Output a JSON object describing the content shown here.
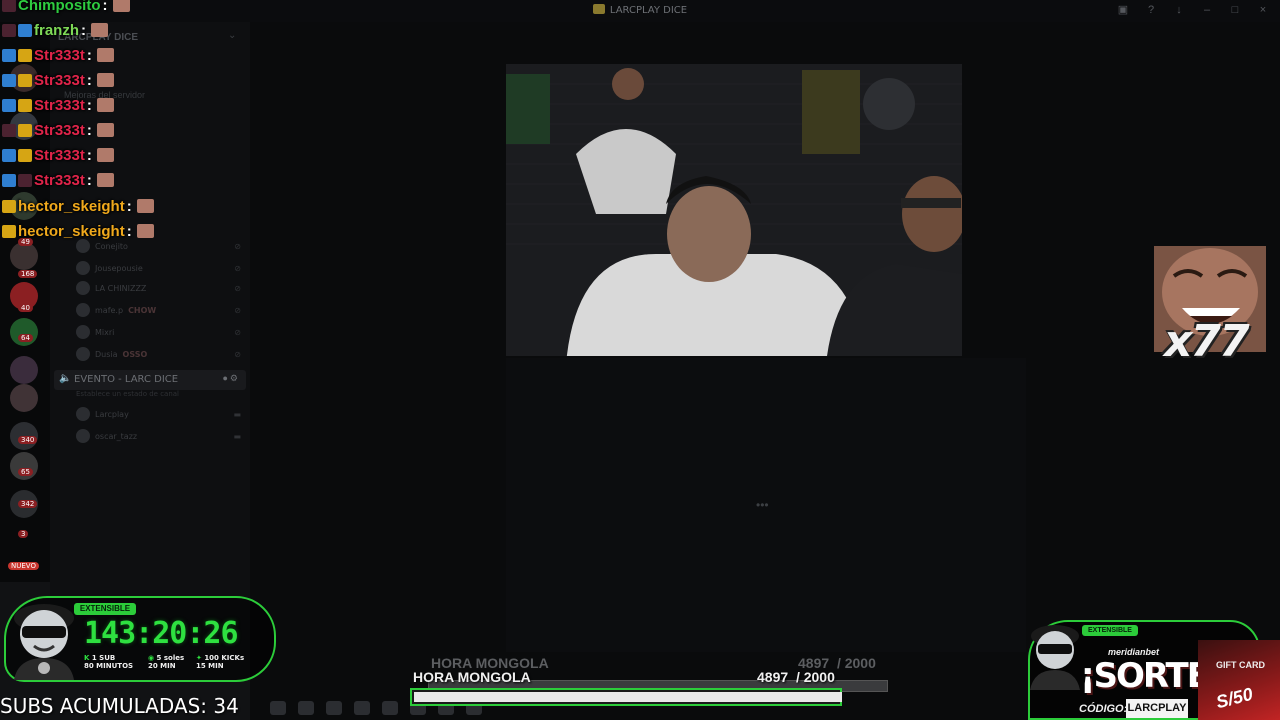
{
  "window": {
    "title": "LARCPLAY DICE"
  },
  "server": {
    "name": "LARCPLAY DICE",
    "boost_label": "Mejoras del servidor"
  },
  "guild_badges": [
    "49",
    "168",
    "40",
    "64",
    "340",
    "65",
    "342",
    "3",
    "NUEVO"
  ],
  "voice_users": [
    {
      "name": "Conejito",
      "tag": ""
    },
    {
      "name": "Jousepousie",
      "tag": ""
    },
    {
      "name": "LA CHINIZZZ",
      "tag": ""
    },
    {
      "name": "mafe.p",
      "tag": "CHOW"
    },
    {
      "name": "Mixri",
      "tag": ""
    },
    {
      "name": "Dusia",
      "tag": "OSSO"
    }
  ],
  "voice_channel": {
    "name": "EVENTO - LARC DICE",
    "status": "Establece un estado de canal",
    "members": [
      "Larcplay",
      "oscar_tazz"
    ]
  },
  "chat": [
    {
      "user": "Chimposito",
      "color": "#2ecc40",
      "badges": [
        "dark"
      ]
    },
    {
      "user": "franzh",
      "color": "#7ed957",
      "badges": [
        "dark",
        "blue"
      ]
    },
    {
      "user": "Str333t",
      "color": "#e0244a",
      "badges": [
        "blue",
        "gold"
      ]
    },
    {
      "user": "Str333t",
      "color": "#e0244a",
      "badges": [
        "blue",
        "gold"
      ]
    },
    {
      "user": "Str333t",
      "color": "#e0244a",
      "badges": [
        "blue",
        "gold"
      ]
    },
    {
      "user": "Str333t",
      "color": "#e0244a",
      "badges": [
        "dark",
        "gold"
      ]
    },
    {
      "user": "Str333t",
      "color": "#e0244a",
      "badges": [
        "blue",
        "gold"
      ]
    },
    {
      "user": "Str333t",
      "color": "#e0244a",
      "badges": [
        "blue",
        "dark"
      ]
    },
    {
      "user": "hector_skeight",
      "color": "#f0a91c",
      "badges": [
        "gold"
      ]
    },
    {
      "user": "hector_skeight",
      "color": "#f0a91c",
      "badges": [
        "gold"
      ]
    }
  ],
  "emote_multiplier": "x77",
  "subathon": {
    "badge": "EXTENSIBLE",
    "timer": "143:20:26",
    "rewards": [
      {
        "top": "1 SUB",
        "bottom": "80 MINUTOS"
      },
      {
        "top": "5 soles",
        "bottom": "20 MIN"
      },
      {
        "top": "100 KICKs",
        "bottom": "15 MIN"
      }
    ],
    "subs_label": "SUBS ACUMULADAS: 34"
  },
  "goal": {
    "label": "HORA MONGOLA",
    "current": "4897",
    "target": "/ 2000",
    "fill_fraction": 1.0
  },
  "sorteo": {
    "badge": "EXTENSIBLE",
    "brand": "meridianbet",
    "title": "¡SORTEO!",
    "code_label": "CÓDIGO:",
    "code": "LARCPLAY",
    "gift_label": "GIFT CARD",
    "gift_amount": "S/50"
  },
  "colors": {
    "accent_green": "#2ccc3a",
    "timer_green": "#2ee040"
  }
}
